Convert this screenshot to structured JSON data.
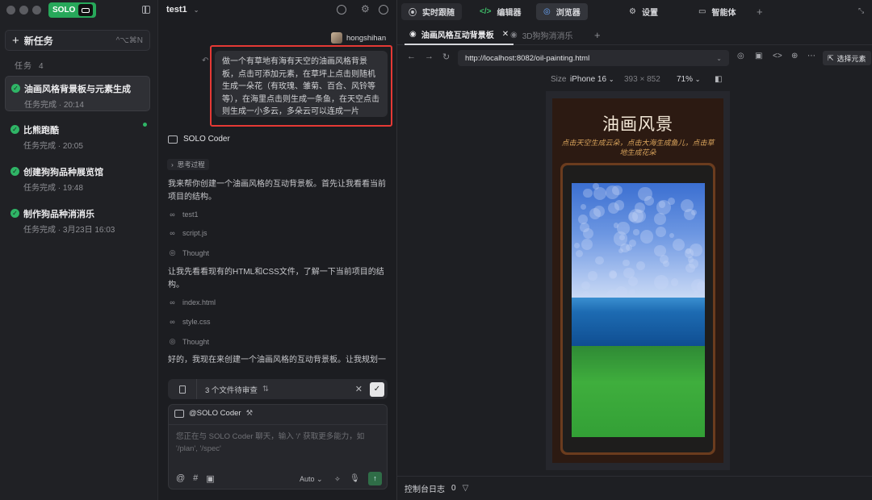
{
  "sidebar": {
    "logo": "SOLO",
    "new_task": "新任务",
    "new_task_shortcut": "^⌥⌘N",
    "tasks_label": "任务",
    "tasks_count": "4",
    "tasks": [
      {
        "title": "油画风格背景板与元素生成",
        "sub": "任务完成 · 20:14"
      },
      {
        "title": "比熊跑酷",
        "sub": "任务完成 · 20:05"
      },
      {
        "title": "创建狗狗品种展览馆",
        "sub": "任务完成 · 19:48"
      },
      {
        "title": "制作狗品种消消乐",
        "sub": "任务完成 · 3月23日 16:03"
      }
    ]
  },
  "chat": {
    "title": "test1",
    "user": "hongshihan",
    "user_message": "做一个有草地有海有天空的油画风格背景板，点击可添加元素，在草坪上点击则随机生成一朵花（有玫瑰、雏菊、百合、风铃等等），在海里点击则生成一条鱼，在天空点击则生成一小多云，多朵云可以连成一片",
    "agent_name": "SOLO Coder",
    "thinking_label": "思考过程",
    "para1": "我来帮你创建一个油画风格的互动背景板。首先让我看看当前项目的结构。",
    "tool1": "test1",
    "tool2": "script.js",
    "thought1": "Thought",
    "para2": "让我先看看现有的HTML和CSS文件，了解一下当前项目的结构。",
    "tool3": "index.html",
    "tool4": "style.css",
    "thought2": "Thought",
    "para3": "好的，我现在来创建一个油画风格的互动背景板。让我规划一下",
    "pending_files": "3 个文件待审查",
    "composer_agent": "@SOLO Coder",
    "composer_placeholder": "您正在与 SOLO Coder 聊天，输入 '/' 获取更多能力，如 '/plan', '/spec'",
    "model": "Auto"
  },
  "right": {
    "top_tabs": [
      "实时跟随",
      "编辑器",
      "浏览器",
      "设置",
      "智能体"
    ],
    "tabs": [
      "油画风格互动背景板",
      "3D狗狗消消乐"
    ],
    "url": "http://localhost:8082/oil-painting.html",
    "pick_element": "选择元素",
    "size_label": "Size",
    "device": "iPhone 16",
    "dims": "393 × 852",
    "zoom": "71%",
    "page_title": "油画风景",
    "page_subtitle": "点击天空生成云朵，点击大海生成鱼儿，点击草地生成花朵",
    "console_label": "控制台日志",
    "console_count": "0"
  }
}
